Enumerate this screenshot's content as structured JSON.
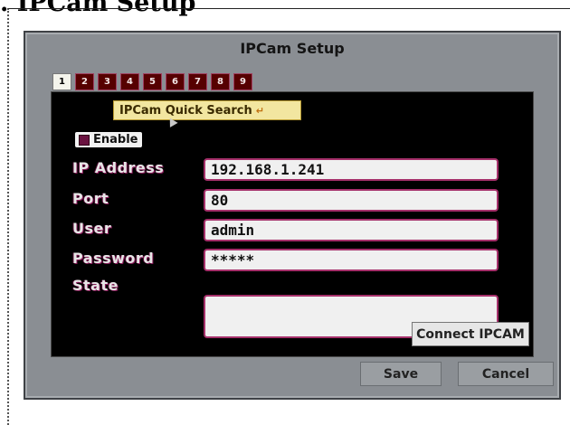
{
  "page": {
    "heading": ". IPCam Setup"
  },
  "dialog": {
    "title": "IPCam Setup",
    "tabs": [
      "1",
      "2",
      "3",
      "4",
      "5",
      "6",
      "7",
      "8",
      "9"
    ],
    "active_tab": "1",
    "quick_search": {
      "label": "IPCam Quick Search",
      "icon": "enter-icon"
    },
    "enable": {
      "label": "Enable",
      "checked": true
    },
    "fields": [
      {
        "label": "IP Address",
        "value": "192.168.1.241"
      },
      {
        "label": "Port",
        "value": "80"
      },
      {
        "label": "User",
        "value": "admin"
      },
      {
        "label": "Password",
        "value": "*****"
      }
    ],
    "state": {
      "label": "State",
      "value": ""
    },
    "connect_button": "Connect IPCAM",
    "save_button": "Save",
    "cancel_button": "Cancel"
  },
  "colors": {
    "dialog_bg": "#8a8e93",
    "panel_bg": "#000000",
    "accent": "#a5306a",
    "tab_bg": "#560000",
    "quick_search_bg": "#f2e6a0"
  }
}
